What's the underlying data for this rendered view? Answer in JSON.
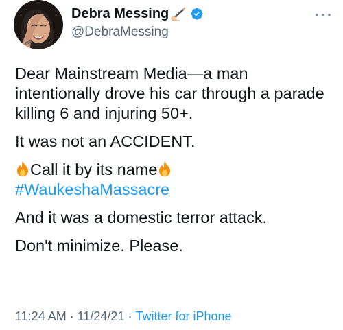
{
  "author": {
    "display_name": "Debra Messing",
    "handle": "@DebraMessing",
    "name_emoji": "writing-hand-icon",
    "verified": true,
    "verified_color": "#1d9bf0"
  },
  "tweet": {
    "line1": "Dear Mainstream Media—a man intentionally drove his car through a parade killing 6 and injuring 50+.",
    "line2": "It was not an ACCIDENT.",
    "line3_text": "Call it by its name",
    "line3_emoji": "fire-icon",
    "hashtag": "#WaukeshaMassacre",
    "line4": "And it was a domestic terror attack.",
    "line5": "Don't minimize. Please."
  },
  "meta": {
    "time": "11:24 AM",
    "date": "11/24/21",
    "separator": "·",
    "source": "Twitter for iPhone"
  },
  "colors": {
    "link": "#1d9bf0",
    "secondary_text": "#536471",
    "primary_text": "#0f1419"
  }
}
